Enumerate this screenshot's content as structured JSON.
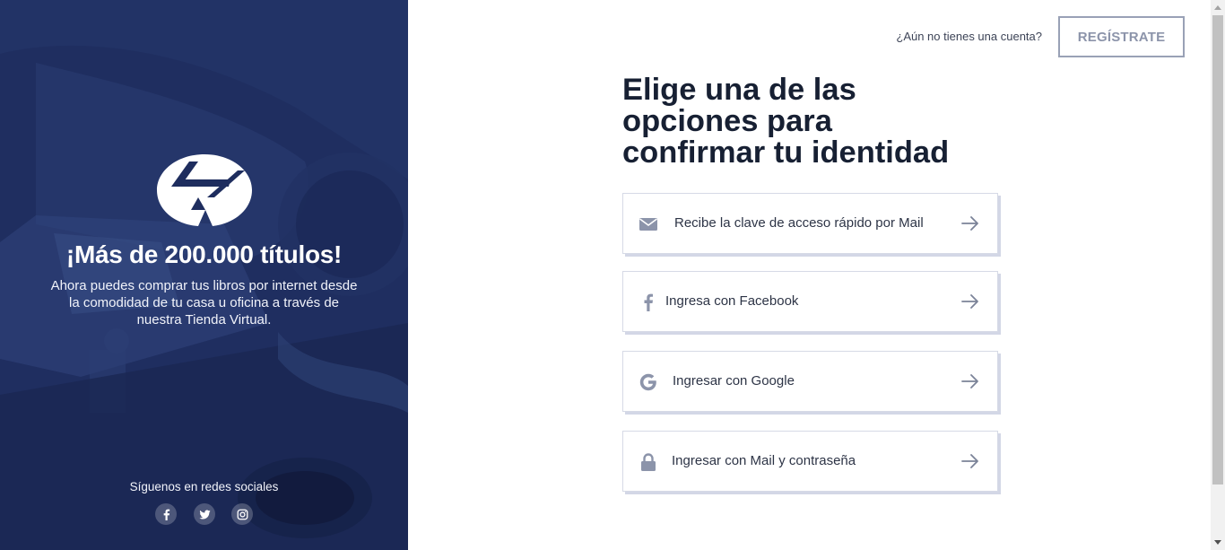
{
  "hero": {
    "title": "¡Más de 200.000 títulos!",
    "text": "Ahora puedes comprar tus libros por internet desde la comodidad de tu casa u oficina a través de nuestra Tienda Virtual."
  },
  "social": {
    "label": "Síguenos en redes sociales",
    "icons": [
      "facebook-icon",
      "twitter-icon",
      "instagram-icon"
    ]
  },
  "header": {
    "no_account": "¿Aún no tienes una cuenta?",
    "register_label": "REGÍSTRATE"
  },
  "main": {
    "heading_lines": [
      "Elige una de las",
      "opciones para",
      "confirmar tu identidad"
    ],
    "options": [
      {
        "label": "Recibe la clave de acceso rápido por Mail",
        "icon": "mail-icon"
      },
      {
        "label": "Ingresa con Facebook",
        "icon": "facebook-icon"
      },
      {
        "label": "Ingresar con Google",
        "icon": "google-icon"
      },
      {
        "label": "Ingresar con Mail y contraseña",
        "icon": "lock-icon"
      }
    ]
  },
  "colors": {
    "left_panel": "#1e2d5e",
    "heading": "#172033",
    "icon_gray": "#8c94aa",
    "border": "#d6dae6"
  }
}
